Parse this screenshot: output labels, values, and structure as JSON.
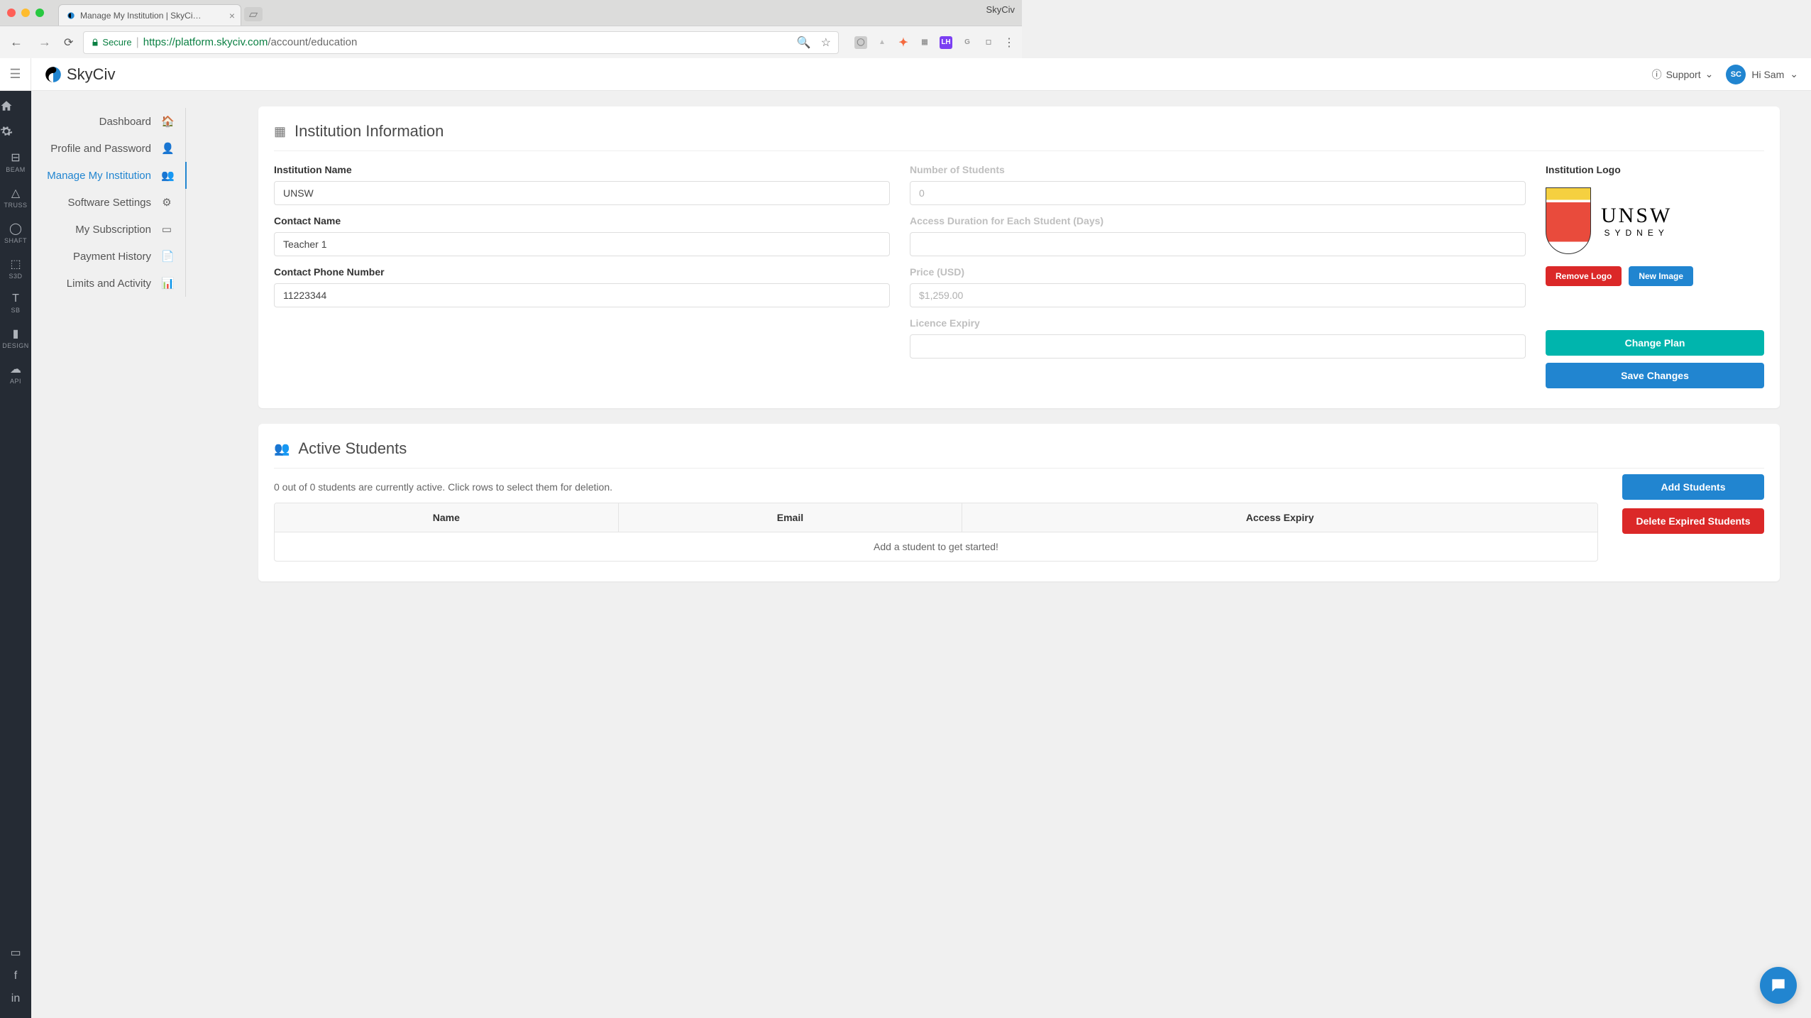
{
  "browser": {
    "tab_title": "Manage My Institution | SkyCi…",
    "window_title": "SkyCiv",
    "secure_label": "Secure",
    "url_host": "https://platform.skyciv.com",
    "url_path": "/account/education"
  },
  "header": {
    "logo_text": "SkyCiv",
    "support": "Support",
    "avatar_initials": "SC",
    "greeting": "Hi Sam"
  },
  "rail": [
    {
      "icon": "home",
      "label": ""
    },
    {
      "icon": "gear",
      "label": ""
    },
    {
      "icon": "beam",
      "label": "BEAM"
    },
    {
      "icon": "truss",
      "label": "TRUSS"
    },
    {
      "icon": "shaft",
      "label": "SHAFT"
    },
    {
      "icon": "s3d",
      "label": "S3D"
    },
    {
      "icon": "sb",
      "label": "SB"
    },
    {
      "icon": "design",
      "label": "DESIGN"
    },
    {
      "icon": "api",
      "label": "API"
    }
  ],
  "sidebar": {
    "items": [
      {
        "label": "Dashboard",
        "icon": "home"
      },
      {
        "label": "Profile and Password",
        "icon": "user"
      },
      {
        "label": "Manage My Institution",
        "icon": "users",
        "active": true
      },
      {
        "label": "Software Settings",
        "icon": "gear"
      },
      {
        "label": "My Subscription",
        "icon": "card"
      },
      {
        "label": "Payment History",
        "icon": "doc"
      },
      {
        "label": "Limits and Activity",
        "icon": "chart"
      }
    ]
  },
  "institution": {
    "section_title": "Institution Information",
    "labels": {
      "name": "Institution Name",
      "contact_name": "Contact Name",
      "contact_phone": "Contact Phone Number",
      "num_students": "Number of Students",
      "access_duration": "Access Duration for Each Student (Days)",
      "price": "Price (USD)",
      "licence_expiry": "Licence Expiry",
      "logo": "Institution Logo"
    },
    "values": {
      "name": "UNSW",
      "contact_name": "Teacher 1",
      "contact_phone": "11223344",
      "num_students": "0",
      "access_duration": "",
      "price": "$1,259.00",
      "licence_expiry": ""
    },
    "logo_text_main": "UNSW",
    "logo_text_sub": "SYDNEY",
    "buttons": {
      "remove_logo": "Remove Logo",
      "new_image": "New Image",
      "change_plan": "Change Plan",
      "save_changes": "Save Changes"
    }
  },
  "students": {
    "section_title": "Active Students",
    "summary": "0 out of 0 students are currently active. Click rows to select them for deletion.",
    "columns": {
      "name": "Name",
      "email": "Email",
      "expiry": "Access Expiry"
    },
    "empty_message": "Add a student to get started!",
    "buttons": {
      "add": "Add Students",
      "delete": "Delete Expired Students"
    }
  }
}
